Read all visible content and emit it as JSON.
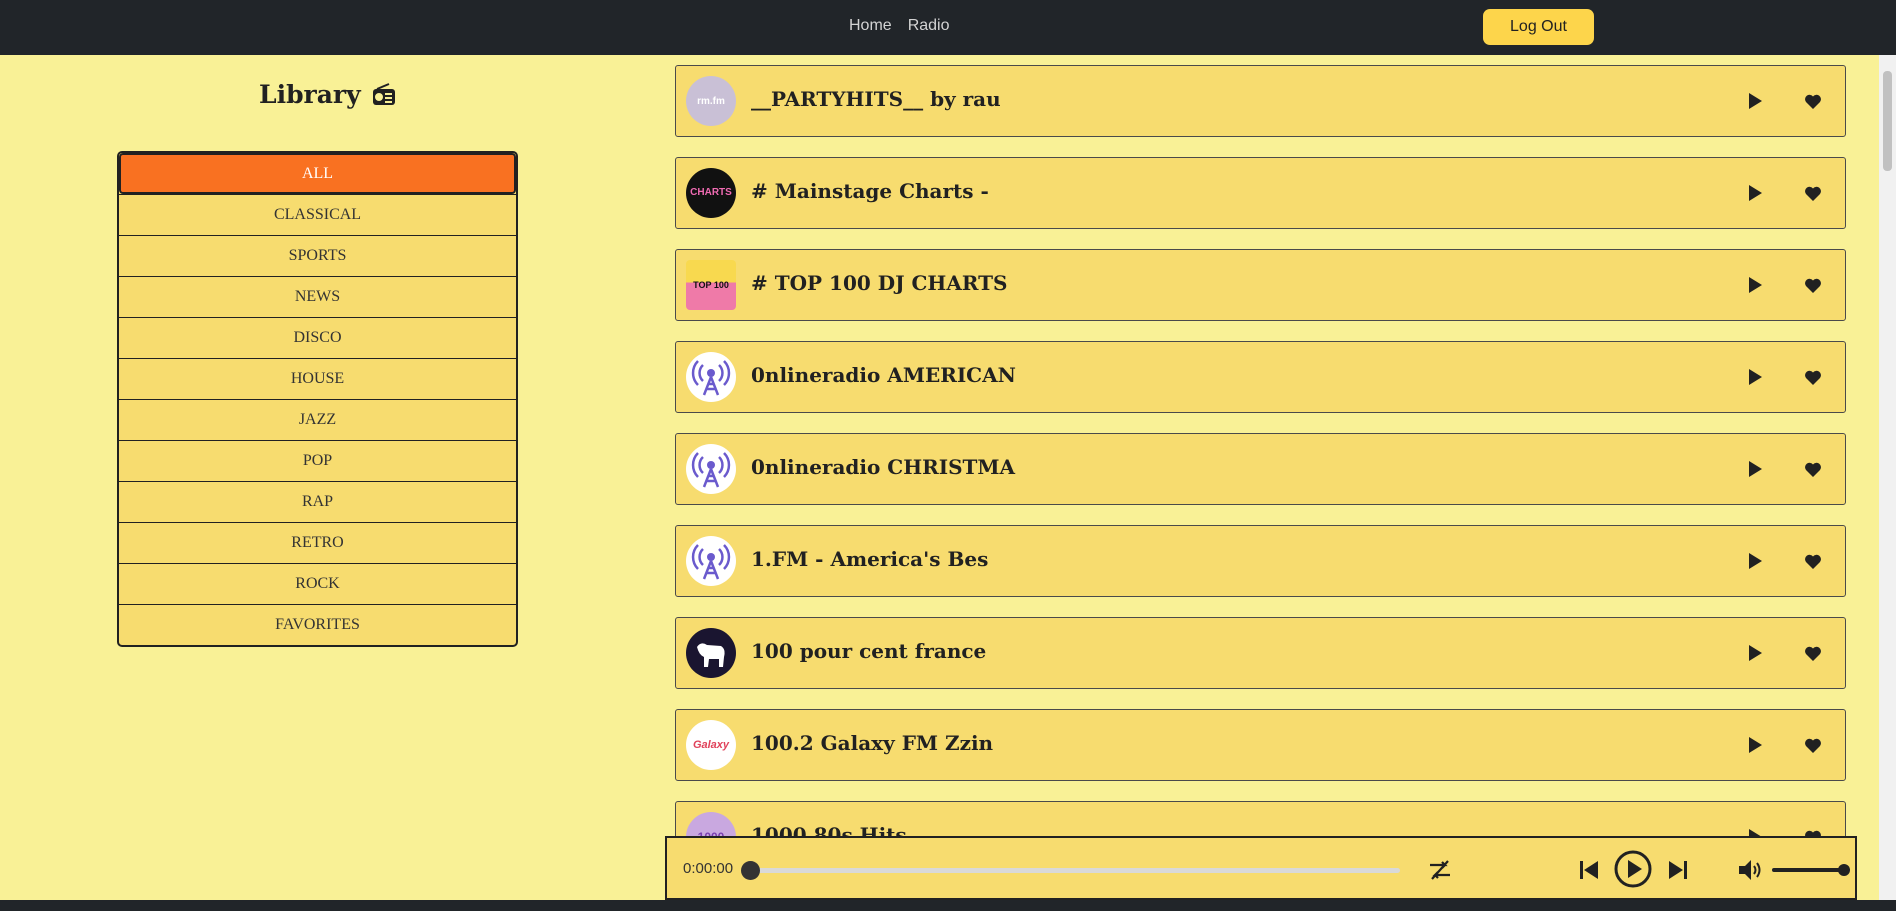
{
  "nav": {
    "links": [
      {
        "label": "Home"
      },
      {
        "label": "Radio"
      }
    ],
    "logout_label": "Log Out"
  },
  "sidebar": {
    "title": "Library",
    "genres": [
      {
        "label": "ALL",
        "active": true
      },
      {
        "label": "CLASSICAL"
      },
      {
        "label": "SPORTS"
      },
      {
        "label": "NEWS"
      },
      {
        "label": "DISCO"
      },
      {
        "label": "HOUSE"
      },
      {
        "label": "JAZZ"
      },
      {
        "label": "POP"
      },
      {
        "label": "RAP"
      },
      {
        "label": "RETRO"
      },
      {
        "label": "ROCK"
      },
      {
        "label": "FAVORITES"
      }
    ]
  },
  "stations": [
    {
      "name": "__PARTYHITS__ by rau",
      "logo_text": "rm.fm",
      "logo_icon": "rm-fm-logo"
    },
    {
      "name": "# Mainstage Charts -",
      "logo_text": "CHARTS",
      "logo_icon": "charts-mainstage-logo"
    },
    {
      "name": "# TOP 100 DJ CHARTS",
      "logo_text": "TOP 100",
      "logo_icon": "deejay-charts-logo"
    },
    {
      "name": "0nlineradio AMERICAN",
      "logo_icon": "radio-tower-icon"
    },
    {
      "name": "0nlineradio CHRISTMA",
      "logo_icon": "radio-tower-icon"
    },
    {
      "name": "1.FM - America's Bes",
      "logo_icon": "radio-tower-icon"
    },
    {
      "name": "100 pour cent france",
      "logo_icon": "dog-logo"
    },
    {
      "name": "100.2 Galaxy FM Zzin",
      "logo_text": "Galaxy",
      "logo_icon": "galaxy-fm-logo"
    },
    {
      "name": "1000 80s Hits",
      "logo_text": "1000",
      "logo_icon": "1000-hits-logo"
    }
  ],
  "player": {
    "time": "0:00:00",
    "progress": 0,
    "volume": 1.0
  },
  "colors": {
    "background": "#f9f196",
    "card": "#f7dc6f",
    "accent": "#f97121",
    "topbar": "#212529",
    "button": "#fdd54b",
    "icon_purple": "#6a5acd"
  }
}
